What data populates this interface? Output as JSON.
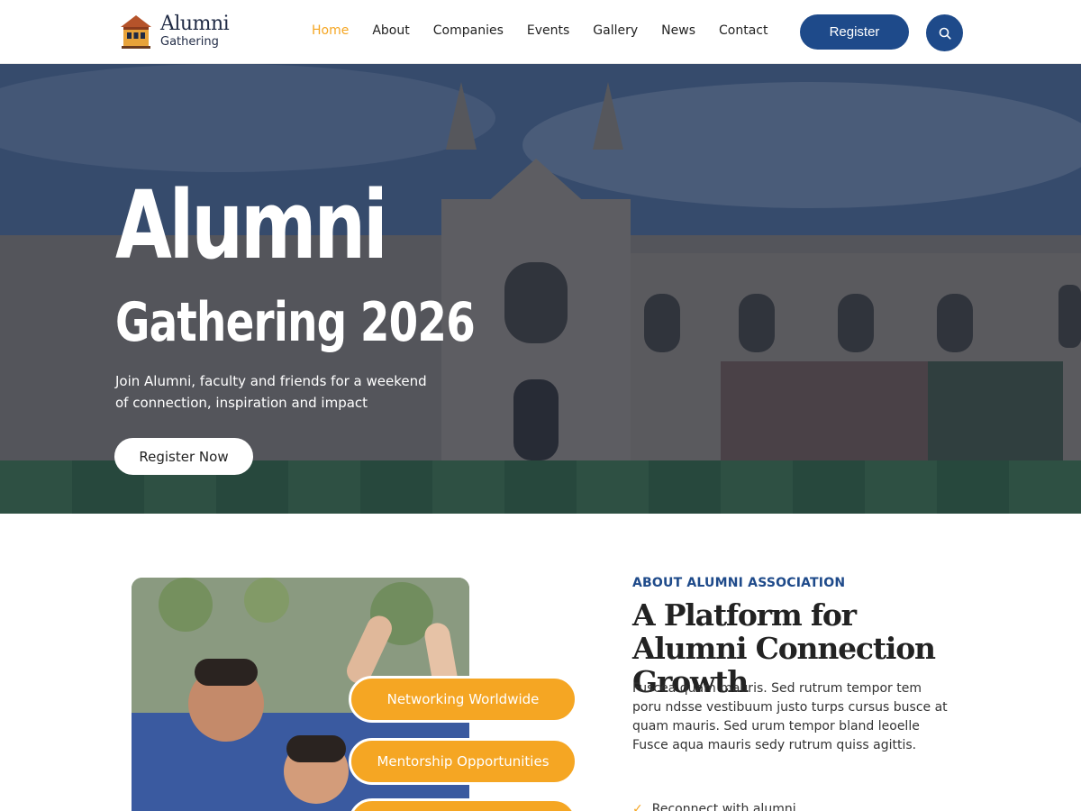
{
  "brand": {
    "line1": "Alumni",
    "line2": "Gathering"
  },
  "nav": [
    {
      "label": "Home",
      "active": true
    },
    {
      "label": "About"
    },
    {
      "label": "Companies"
    },
    {
      "label": "Events"
    },
    {
      "label": "Gallery"
    },
    {
      "label": "News"
    },
    {
      "label": "Contact"
    }
  ],
  "header": {
    "register_label": "Register",
    "search_icon": "search-icon"
  },
  "hero": {
    "title": "Alumni",
    "subtitle": "Gathering 2026",
    "text": "Join Alumni, faculty and friends for a weekend of connection, inspiration and impact",
    "cta_label": "Register Now"
  },
  "about": {
    "eyebrow": "ABOUT ALUMNI ASSOCIATION",
    "title": "A Platform for Alumni Connection Growth",
    "text": "Fuscea quam mauris. Sed rutrum tempor tem poru ndsse vestibuum justo turps cursus busce at quam mauris. Sed urum tempor bland leoelle Fusce aqua mauris sedy rutrum quiss agittis.",
    "features": [
      "Networking Worldwide",
      "Mentorship Opportunities"
    ],
    "checklist": [
      "Reconnect with alumni"
    ]
  },
  "colors": {
    "primary": "#1e4a8a",
    "accent": "#f5a623"
  }
}
